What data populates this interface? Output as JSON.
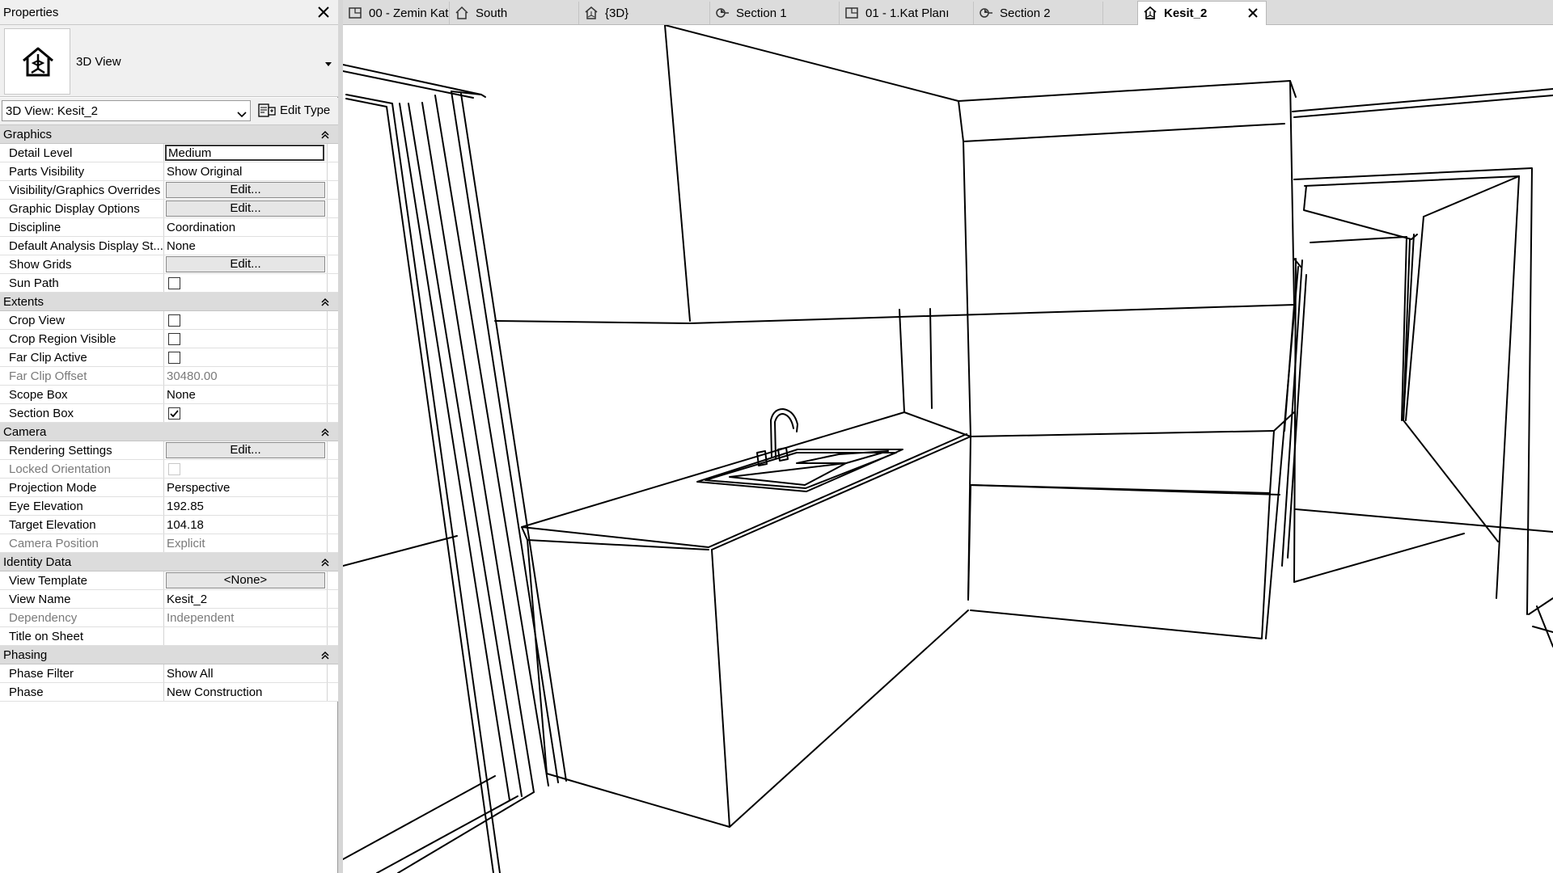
{
  "properties": {
    "title": "Properties",
    "type_name": "3D View",
    "view_selector": "3D View: Kesit_2",
    "edit_type_label": "Edit Type",
    "groups": [
      {
        "label": "Graphics",
        "rows": [
          {
            "name": "Detail Level",
            "value": "Medium",
            "kind": "box"
          },
          {
            "name": "Parts Visibility",
            "value": "Show Original",
            "kind": "text"
          },
          {
            "name": "Visibility/Graphics Overrides",
            "value": "Edit...",
            "kind": "button"
          },
          {
            "name": "Graphic Display Options",
            "value": "Edit...",
            "kind": "button"
          },
          {
            "name": "Discipline",
            "value": "Coordination",
            "kind": "text"
          },
          {
            "name": "Default Analysis Display St...",
            "value": "None",
            "kind": "text"
          },
          {
            "name": "Show Grids",
            "value": "Edit...",
            "kind": "button"
          },
          {
            "name": "Sun Path",
            "value": false,
            "kind": "check"
          }
        ]
      },
      {
        "label": "Extents",
        "rows": [
          {
            "name": "Crop View",
            "value": false,
            "kind": "check"
          },
          {
            "name": "Crop Region Visible",
            "value": false,
            "kind": "check"
          },
          {
            "name": "Far Clip Active",
            "value": false,
            "kind": "check"
          },
          {
            "name": "Far Clip Offset",
            "value": "30480.00",
            "kind": "text",
            "dim": true
          },
          {
            "name": "Scope Box",
            "value": "None",
            "kind": "text"
          },
          {
            "name": "Section Box",
            "value": true,
            "kind": "check"
          }
        ]
      },
      {
        "label": "Camera",
        "rows": [
          {
            "name": "Rendering Settings",
            "value": "Edit...",
            "kind": "button"
          },
          {
            "name": "Locked Orientation",
            "value": false,
            "kind": "check",
            "dim": true
          },
          {
            "name": "Projection Mode",
            "value": "Perspective",
            "kind": "text"
          },
          {
            "name": "Eye Elevation",
            "value": "192.85",
            "kind": "text"
          },
          {
            "name": "Target Elevation",
            "value": "104.18",
            "kind": "text"
          },
          {
            "name": "Camera Position",
            "value": "Explicit",
            "kind": "text",
            "dim": true
          }
        ]
      },
      {
        "label": "Identity Data",
        "rows": [
          {
            "name": "View Template",
            "value": "<None>",
            "kind": "button"
          },
          {
            "name": "View Name",
            "value": "Kesit_2",
            "kind": "text"
          },
          {
            "name": "Dependency",
            "value": "Independent",
            "kind": "text",
            "dim": true
          },
          {
            "name": "Title on Sheet",
            "value": "",
            "kind": "text"
          }
        ]
      },
      {
        "label": "Phasing",
        "rows": [
          {
            "name": "Phase Filter",
            "value": "Show All",
            "kind": "text"
          },
          {
            "name": "Phase",
            "value": "New Construction",
            "kind": "text"
          }
        ]
      }
    ]
  },
  "tabs": [
    {
      "label": "00 - Zemin Kat",
      "icon": "floor-plan-icon",
      "active": false
    },
    {
      "label": "South",
      "icon": "elevation-icon",
      "active": false
    },
    {
      "label": "{3D}",
      "icon": "3d-view-icon",
      "active": false
    },
    {
      "label": "Section 1",
      "icon": "section-icon",
      "active": false
    },
    {
      "label": "01 - 1.Kat Planı",
      "icon": "floor-plan-icon",
      "active": false
    },
    {
      "label": "Section 2",
      "icon": "section-icon",
      "active": false
    },
    {
      "label": "Kesit_2",
      "icon": "3d-view-icon",
      "active": true
    }
  ]
}
